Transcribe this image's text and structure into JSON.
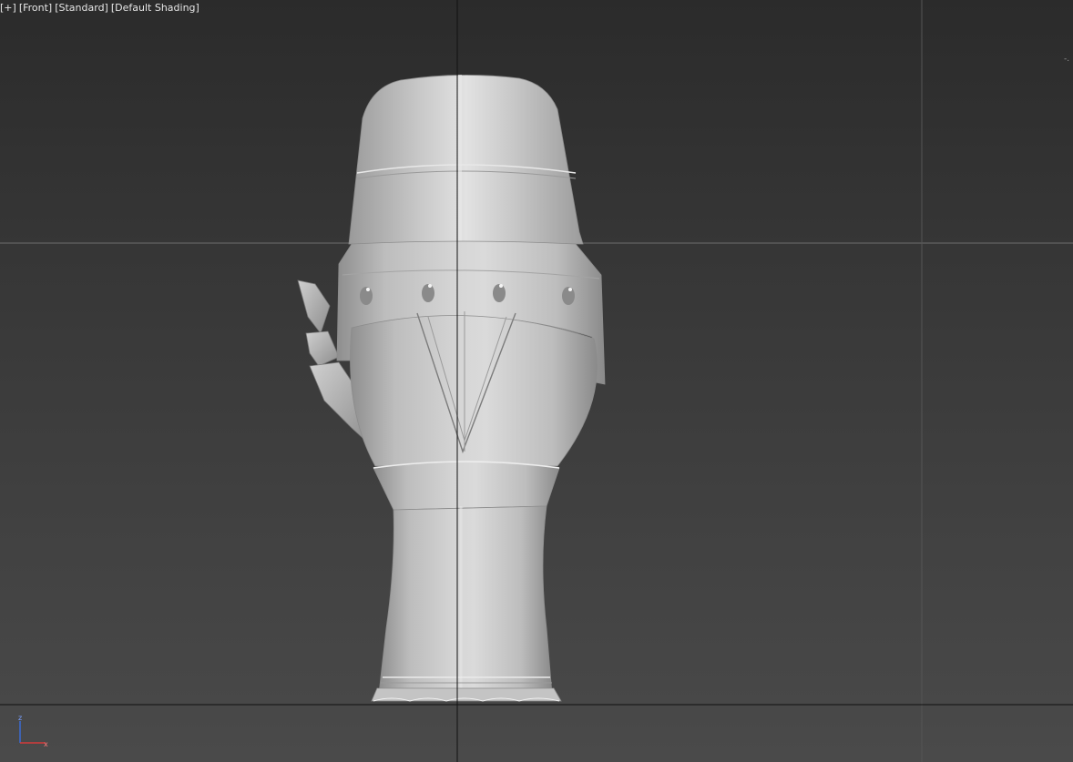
{
  "viewport": {
    "label_plus": "[+]",
    "label_view": "[Front]",
    "label_standard": "[Standard]",
    "label_shading": "[Default Shading]",
    "axis_labels": {
      "z": "z",
      "x": "x"
    },
    "right_mark": "-.",
    "colors": {
      "background_top": "#2b2b2b",
      "background_bottom": "#4a4a4a",
      "grid_line": "#6e6e6e",
      "axis_line": "#111111",
      "model": "#cfcfcf",
      "gizmo_z": "#3a6ad4",
      "gizmo_x": "#d43a3a"
    },
    "model_name": "hand-model"
  }
}
